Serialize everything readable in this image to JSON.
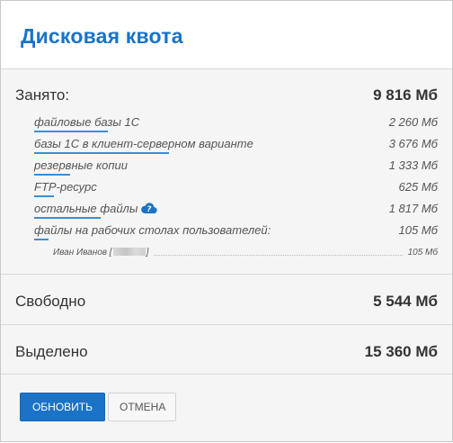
{
  "title": "Дисковая квота",
  "used": {
    "label": "Занято:",
    "value": "9 816 Мб",
    "items": [
      {
        "label": "файловые базы 1С",
        "value": "2 260 Мб"
      },
      {
        "label": "базы 1С в клиент-серверном варианте",
        "value": "3 676 Мб"
      },
      {
        "label": "резервные копии",
        "value": "1 333 Мб"
      },
      {
        "label": "FTP-ресурс",
        "value": "625 Мб"
      },
      {
        "label": "остальные файлы",
        "value": "1 817 Мб",
        "icon": "cloud-help-icon"
      },
      {
        "label": "файлы на рабочих столах пользователей:",
        "value": "105 Мб"
      }
    ],
    "subitems": [
      {
        "name_prefix": "Иван Иванов [",
        "name_suffix": "]",
        "value": "105 Мб"
      }
    ]
  },
  "free": {
    "label": "Свободно",
    "value": "5 544 Мб"
  },
  "allocated": {
    "label": "Выделено",
    "value": "15 360 Мб"
  },
  "buttons": {
    "refresh": "ОБНОВИТЬ",
    "cancel": "ОТМЕНА"
  },
  "colors": {
    "accent": "#1a73c7",
    "underline": "#3a8fd8",
    "background": "#f5f5f5"
  }
}
